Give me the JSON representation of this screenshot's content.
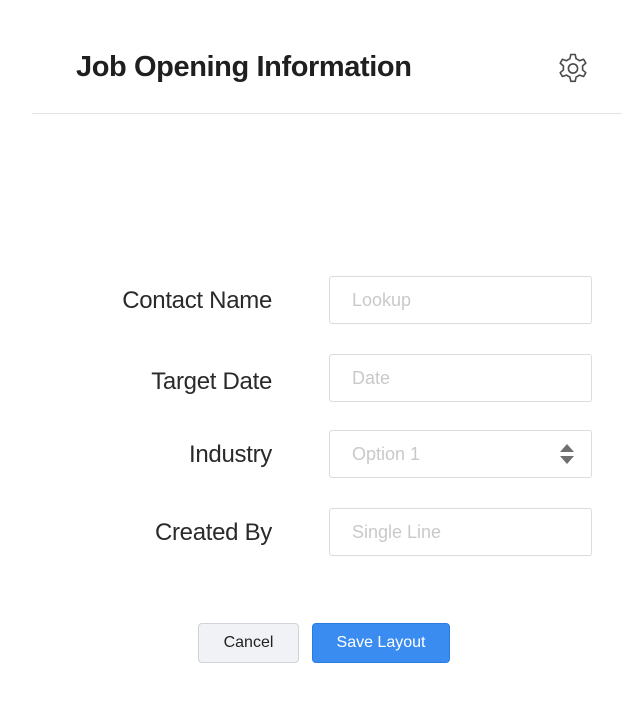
{
  "header": {
    "title": "Job Opening Information",
    "settings_icon": "gear-icon"
  },
  "fields": [
    {
      "label": "Contact Name",
      "placeholder": "Lookup",
      "type": "lookup"
    },
    {
      "label": "Target Date",
      "placeholder": "Date",
      "type": "date"
    },
    {
      "label": "Industry",
      "placeholder": "Option 1",
      "type": "select"
    },
    {
      "label": "Created By",
      "placeholder": "Single Line",
      "type": "single-line"
    }
  ],
  "actions": {
    "cancel_label": "Cancel",
    "save_label": "Save Layout"
  },
  "colors": {
    "primary": "#3b8cf0",
    "placeholder": "#c9c9c9",
    "border": "#dcdcdc"
  }
}
